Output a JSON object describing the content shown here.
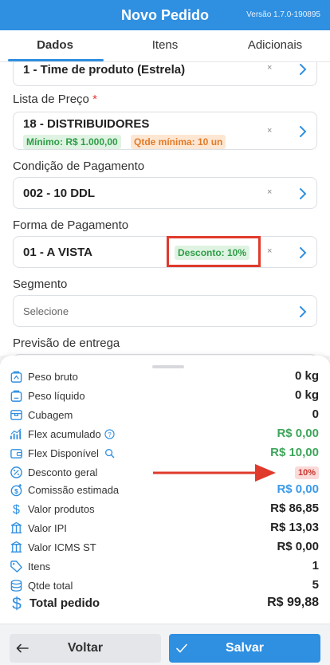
{
  "header": {
    "title": "Novo Pedido",
    "version": "Versão 1.7.0-190895"
  },
  "tabs": [
    {
      "label": "Dados"
    },
    {
      "label": "Itens"
    },
    {
      "label": "Adicionais"
    }
  ],
  "form": {
    "produto": {
      "value": "1 - Time de produto (Estrela)"
    },
    "lista_preco": {
      "label": "Lista de Preço",
      "required_mark": "*",
      "value": "18 - DISTRIBUIDORES",
      "min_tag": "Mínimo: R$ 1.000,00",
      "qty_tag": "Qtde mínima: 10 un"
    },
    "condicao_pagamento": {
      "label": "Condição de Pagamento",
      "value": "002 - 10 DDL"
    },
    "forma_pagamento": {
      "label": "Forma de Pagamento",
      "value": "01 - A VISTA",
      "discount_tag": "Desconto: 10%"
    },
    "segmento": {
      "label": "Segmento",
      "placeholder": "Selecione"
    },
    "previsao_entrega": {
      "label": "Previsão de entrega"
    },
    "clear_glyph": "×"
  },
  "summary": {
    "peso_bruto": {
      "label": "Peso bruto",
      "value": "0 kg"
    },
    "peso_liquido": {
      "label": "Peso líquido",
      "value": "0 kg"
    },
    "cubagem": {
      "label": "Cubagem",
      "value": "0"
    },
    "flex_acumulado": {
      "label": "Flex acumulado",
      "value": "R$ 0,00"
    },
    "flex_disponivel": {
      "label": "Flex Disponível",
      "value": "R$ 10,00"
    },
    "desconto_geral": {
      "label": "Desconto geral",
      "value": "10%"
    },
    "comissao": {
      "label": "Comissão estimada",
      "value": "R$ 0,00"
    },
    "valor_produtos": {
      "label": "Valor produtos",
      "value": "R$ 86,85"
    },
    "valor_ipi": {
      "label": "Valor IPI",
      "value": "R$ 13,03"
    },
    "valor_icms_st": {
      "label": "Valor ICMS ST",
      "value": "R$ 0,00"
    },
    "itens": {
      "label": "Itens",
      "value": "1"
    },
    "qtde_total": {
      "label": "Qtde total",
      "value": "5"
    },
    "total_pedido": {
      "label": "Total pedido",
      "value": "R$ 99,88"
    }
  },
  "footer": {
    "back_label": "Voltar",
    "save_label": "Salvar"
  },
  "colors": {
    "primary": "#2f8fe0",
    "green": "#3ea55a",
    "blue_value": "#3b9ae8",
    "annotation_red": "#e03a2c"
  },
  "icons": [
    "weight-icon",
    "box-icon",
    "flex-chart-icon",
    "wallet-icon",
    "percent-icon",
    "commission-icon",
    "dollar-icon",
    "tax-icon",
    "tag-icon",
    "stack-icon",
    "chevron-right-icon",
    "help-icon",
    "search-icon",
    "arrow-left-icon",
    "check-icon"
  ]
}
